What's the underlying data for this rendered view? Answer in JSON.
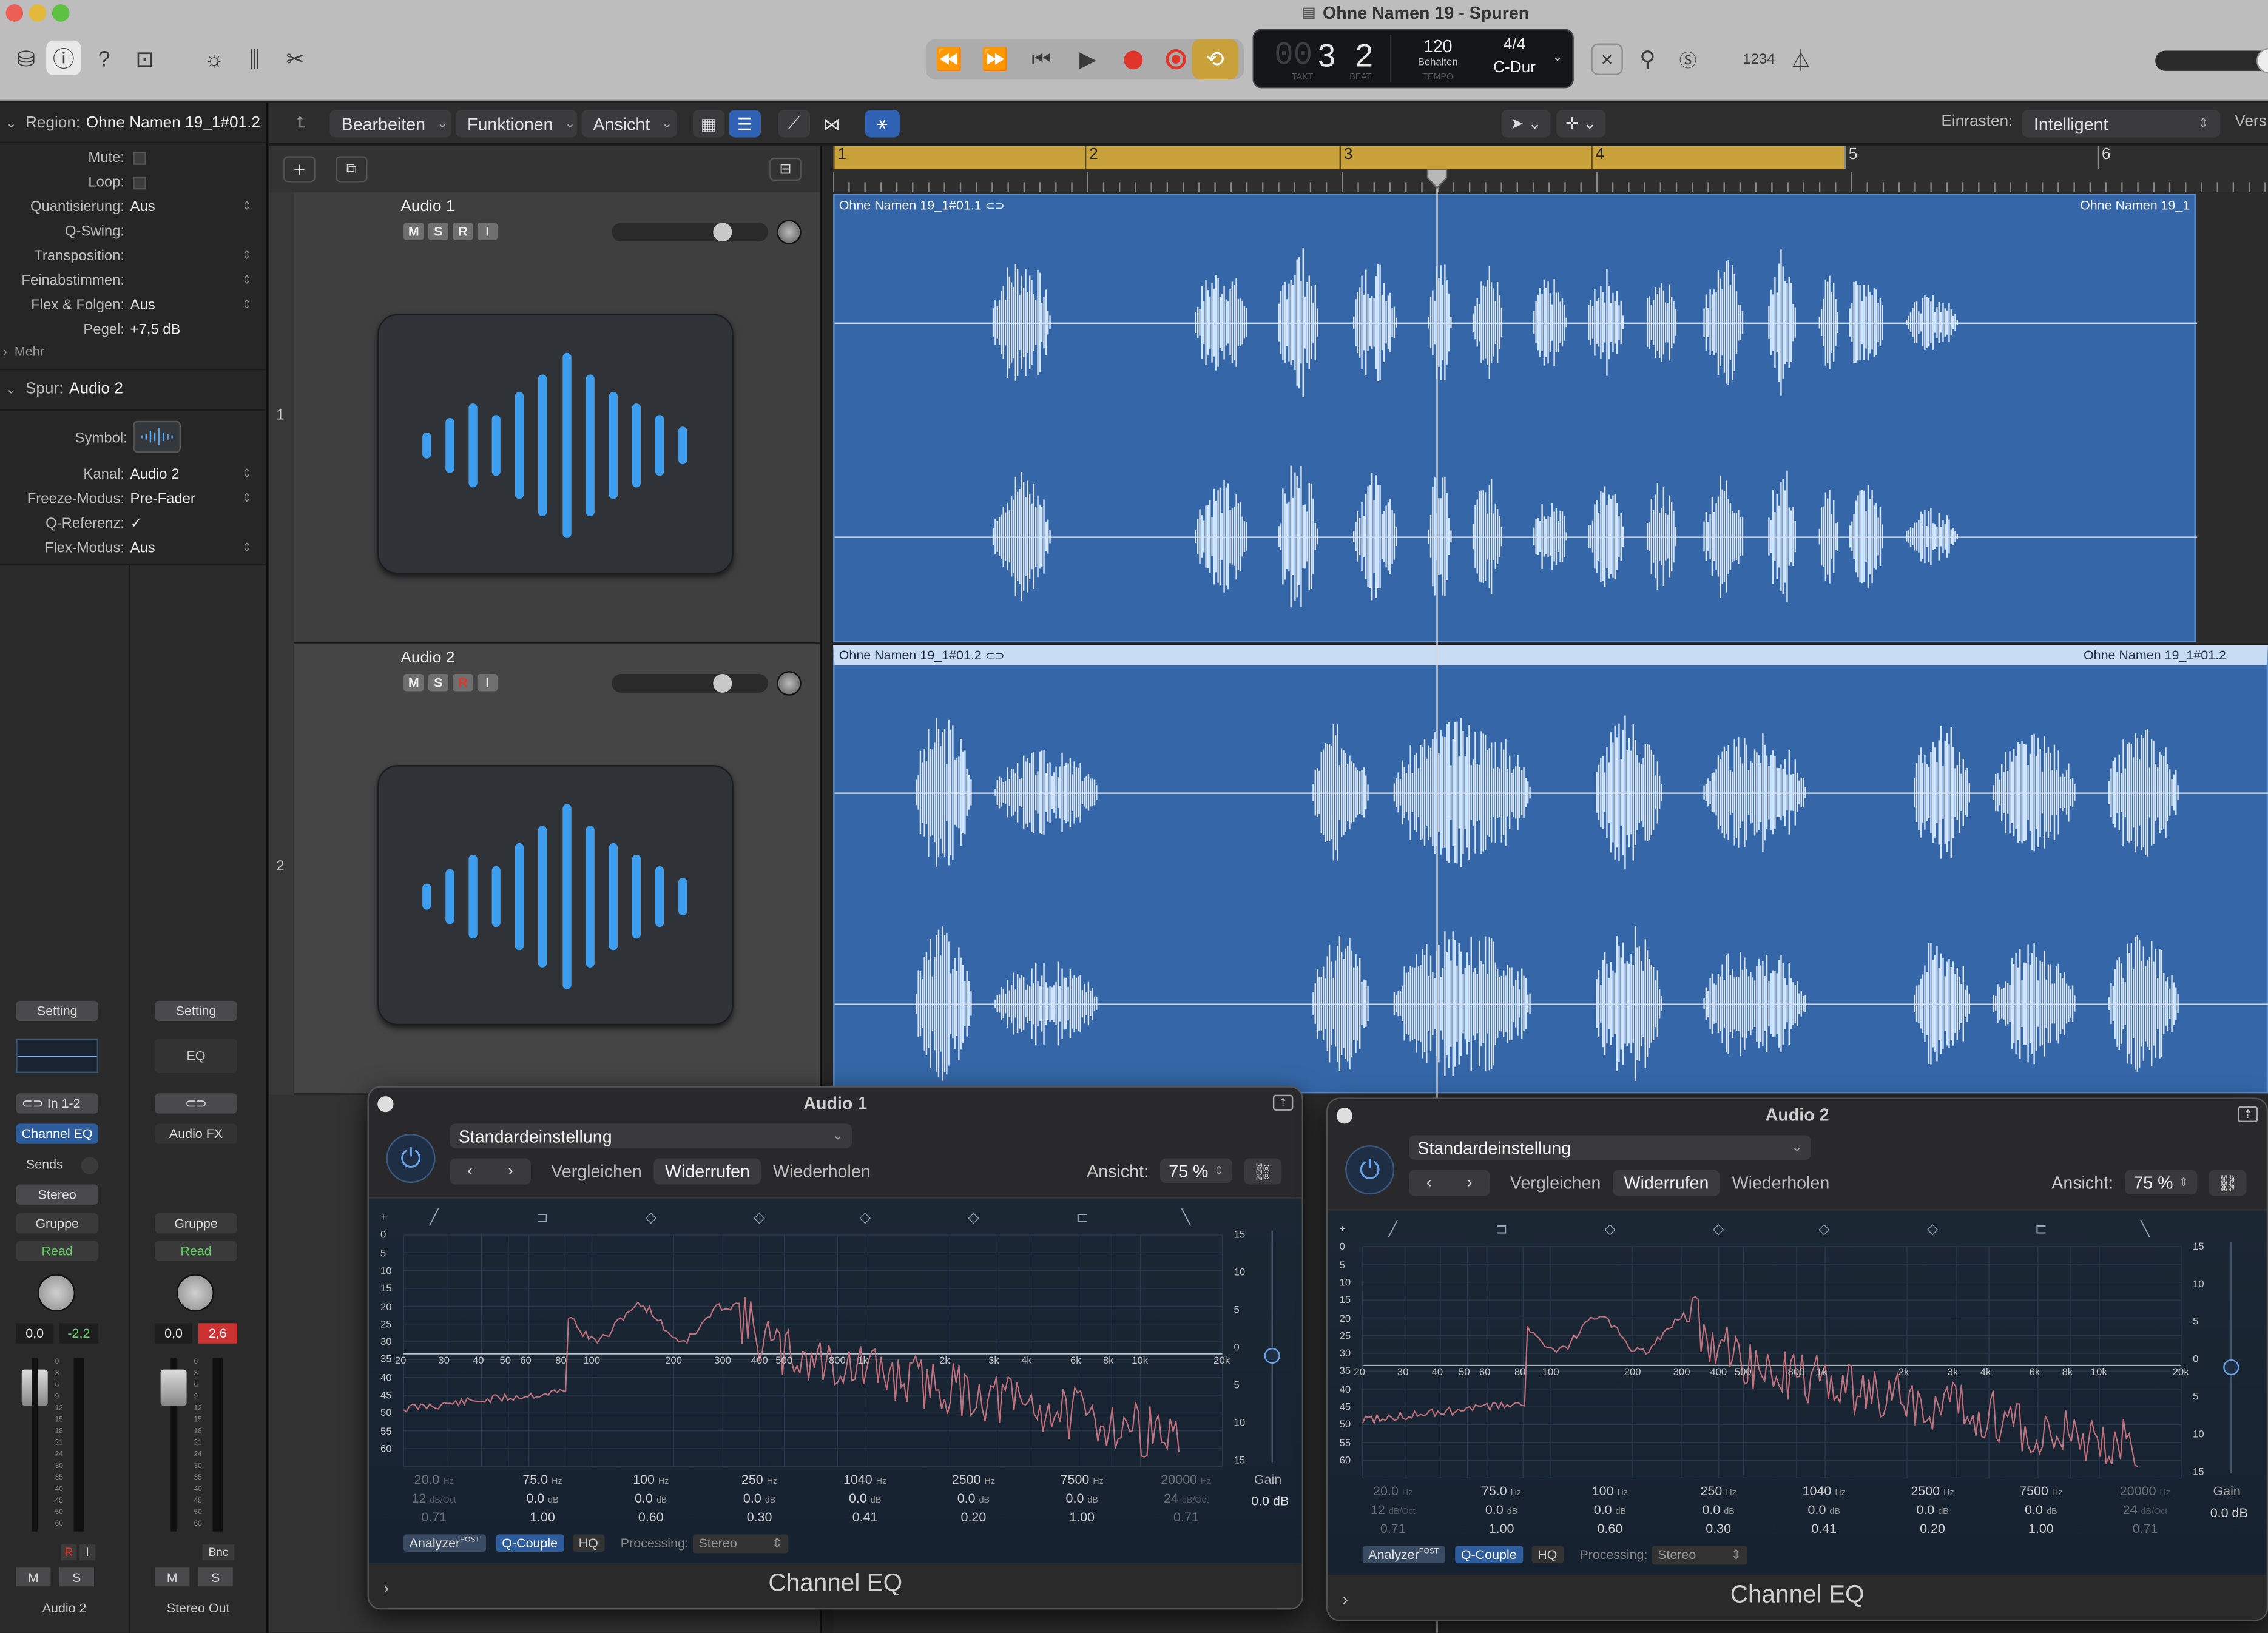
{
  "window": {
    "title": "Ohne Namen 19 - Spuren"
  },
  "transport": {
    "bar": "3",
    "beat": "2",
    "bar_label": "TAKT",
    "beat_label": "BEAT",
    "tempo": "120",
    "tempo_mode": "Behalten",
    "tempo_label": "TEMPO",
    "signature": "4/4",
    "key": "C-Dur",
    "count_in": "1234"
  },
  "toolbar": {
    "edit_menu": "Bearbeiten",
    "functions_menu": "Funktionen",
    "view_menu": "Ansicht",
    "snap_label": "Einrasten:",
    "snap_value": "Intelligent",
    "cut_text": "Vers"
  },
  "inspector": {
    "region_label": "Region:",
    "region_name": "Ohne Namen 19_1#01.2",
    "region_params": [
      {
        "label": "Mute:",
        "value": ""
      },
      {
        "label": "Loop:",
        "value": ""
      },
      {
        "label": "Quantisierung:",
        "value": "Aus"
      },
      {
        "label": "Q-Swing:",
        "value": ""
      },
      {
        "label": "Transposition:",
        "value": ""
      },
      {
        "label": "Feinabstimmen:",
        "value": ""
      },
      {
        "label": "Flex & Folgen:",
        "value": "Aus"
      },
      {
        "label": "Pegel:",
        "value": "+7,5 dB"
      }
    ],
    "more": "Mehr",
    "track_label": "Spur:",
    "track_name": "Audio 2",
    "symbol_label": "Symbol:",
    "track_params": [
      {
        "label": "Kanal:",
        "value": "Audio 2"
      },
      {
        "label": "Freeze-Modus:",
        "value": "Pre-Fader"
      },
      {
        "label": "Q-Referenz:",
        "value": "✓"
      },
      {
        "label": "Flex-Modus:",
        "value": "Aus"
      }
    ]
  },
  "tracks": [
    {
      "number": "1",
      "name": "Audio 1",
      "m": "M",
      "s": "S",
      "r": "R",
      "i": "I",
      "region_name": "Ohne Namen 19_1#01.1",
      "region_name_right": "Ohne Namen 19_1"
    },
    {
      "number": "2",
      "name": "Audio 2",
      "m": "M",
      "s": "S",
      "r": "R",
      "i": "I",
      "region_name": "Ohne Namen 19_1#01.2",
      "region_name_right": "Ohne Namen 19_1#01.2"
    }
  ],
  "ruler": {
    "bars": [
      "1",
      "2",
      "3",
      "4",
      "5",
      "6"
    ]
  },
  "mixer": {
    "strip1": {
      "setting": "Setting",
      "input": "In 1-2",
      "plugin": "Channel EQ",
      "sends": "Sends",
      "output": "Stereo",
      "group": "Gruppe",
      "automation": "Read",
      "pan": "0,0",
      "peak": "-2,2",
      "r": "R",
      "i": "I",
      "m": "M",
      "s": "S",
      "name": "Audio 2"
    },
    "strip2": {
      "setting": "Setting",
      "eq": "EQ",
      "plugin": "Audio FX",
      "group": "Gruppe",
      "automation": "Read",
      "pan": "0,0",
      "peak": "2,6",
      "bnc": "Bnc",
      "m": "M",
      "s": "S",
      "name": "Stereo Out"
    },
    "meter_scale": [
      "0",
      "3",
      "6",
      "9",
      "12",
      "15",
      "18",
      "21",
      "24",
      "30",
      "35",
      "40",
      "45",
      "50",
      "60"
    ]
  },
  "eq_windows": [
    {
      "title": "Audio 1",
      "preset": "Standardeinstellung",
      "compare": "Vergleichen",
      "undo": "Widerrufen",
      "redo": "Wiederholen",
      "view_label": "Ansicht:",
      "view_value": "75 %",
      "gain_label": "Gain",
      "gain_value": "0.0 dB",
      "plugin_name": "Channel EQ",
      "analyzer": "Analyzer",
      "analyzer_sup": "POST",
      "qcouple": "Q-Couple",
      "hq": "HQ",
      "processing_label": "Processing:",
      "processing_value": "Stereo"
    },
    {
      "title": "Audio 2",
      "preset": "Standardeinstellung",
      "compare": "Vergleichen",
      "undo": "Widerrufen",
      "redo": "Wiederholen",
      "view_label": "Ansicht:",
      "view_value": "75 %",
      "gain_label": "Gain",
      "gain_value": "0.0 dB",
      "plugin_name": "Channel EQ",
      "analyzer": "Analyzer",
      "analyzer_sup": "POST",
      "qcouple": "Q-Couple",
      "hq": "HQ",
      "processing_label": "Processing:",
      "processing_value": "Stereo"
    }
  ],
  "eq_scale": {
    "freq_labels": [
      "20",
      "30",
      "40",
      "50",
      "60",
      "80",
      "100",
      "200",
      "300",
      "400",
      "500",
      "800",
      "1k",
      "2k",
      "3k",
      "4k",
      "6k",
      "8k",
      "10k",
      "20k"
    ],
    "left_db": [
      "+",
      "0",
      "5",
      "10",
      "15",
      "20",
      "25",
      "30",
      "35",
      "40",
      "45",
      "50",
      "55",
      "60"
    ],
    "right_db": [
      "15",
      "10",
      "5",
      "0",
      "5",
      "10",
      "15"
    ]
  },
  "eq_bands": [
    {
      "freq": "20.0",
      "freq_unit": "Hz",
      "gain": "12",
      "gain_unit": "dB/Oct",
      "q": "0.71"
    },
    {
      "freq": "75.0",
      "freq_unit": "Hz",
      "gain": "0.0",
      "gain_unit": "dB",
      "q": "1.00"
    },
    {
      "freq": "100",
      "freq_unit": "Hz",
      "gain": "0.0",
      "gain_unit": "dB",
      "q": "0.60"
    },
    {
      "freq": "250",
      "freq_unit": "Hz",
      "gain": "0.0",
      "gain_unit": "dB",
      "q": "0.30"
    },
    {
      "freq": "1040",
      "freq_unit": "Hz",
      "gain": "0.0",
      "gain_unit": "dB",
      "q": "0.41"
    },
    {
      "freq": "2500",
      "freq_unit": "Hz",
      "gain": "0.0",
      "gain_unit": "dB",
      "q": "0.20"
    },
    {
      "freq": "7500",
      "freq_unit": "Hz",
      "gain": "0.0",
      "gain_unit": "dB",
      "q": "1.00"
    },
    {
      "freq": "20000",
      "freq_unit": "Hz",
      "gain": "24",
      "gain_unit": "dB/Oct",
      "q": "0.71"
    }
  ],
  "colors": {
    "accent": "#c9a13a",
    "region": "#3567a8",
    "waveform": "#d7e6fb",
    "record": "#e0352b",
    "eq_curve": "#c0727f",
    "plugin_blue": "#2e5d9e"
  }
}
